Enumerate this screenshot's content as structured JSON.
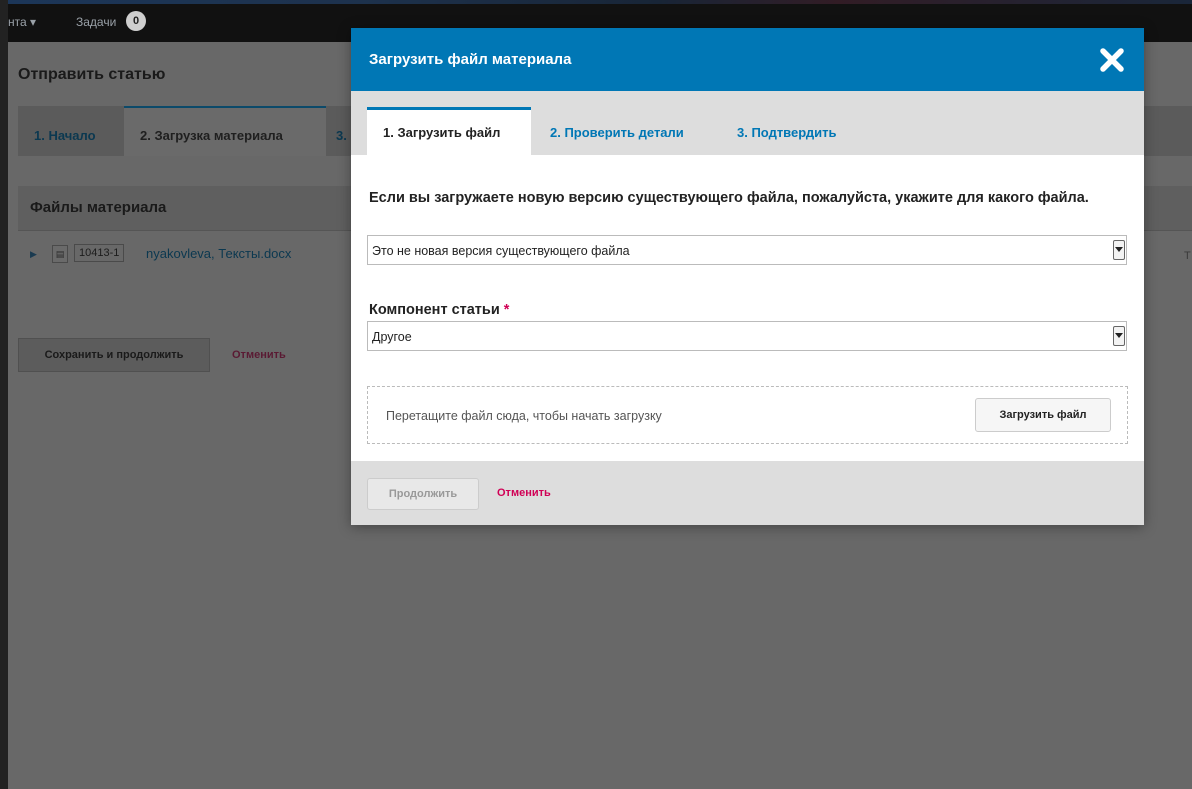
{
  "background": {
    "topbar": {
      "menu_label": "нта ▾",
      "tasks_label": "Задачи",
      "tasks_count": "0"
    },
    "page_title": "Отправить статью",
    "tabs": [
      "1. Начало",
      "2. Загрузка материала",
      "3."
    ],
    "files_section": {
      "title": "Файлы материала",
      "row": {
        "id": "10413-1",
        "name": "nyakovleva, Тексты.docx"
      }
    },
    "save_button": "Сохранить и продолжить",
    "cancel_link": "Отменить",
    "right_edge_text": "T"
  },
  "modal": {
    "title": "Загрузить файл материала",
    "close_icon": "close-x-icon",
    "tabs": [
      {
        "label": "1. Загрузить файл",
        "active": true
      },
      {
        "label": "2. Проверить детали",
        "active": false
      },
      {
        "label": "3. Подтвердить",
        "active": false
      }
    ],
    "revision_question": "Если вы загружаете новую версию существующего файла, пожалуйста, укажите для какого файла.",
    "revision_select_value": "Это не новая версия существующего файла",
    "component_label": "Компонент статьи",
    "required_marker": "*",
    "component_select_value": "Другое",
    "dropzone_text": "Перетащите файл сюда, чтобы начать загрузку",
    "upload_button": "Загрузить файл",
    "continue_button": "Продолжить",
    "cancel_link": "Отменить"
  },
  "colors": {
    "header_blue": "#0077b5",
    "cancel_pink": "#d00055",
    "overlay_gray": "#686868"
  }
}
